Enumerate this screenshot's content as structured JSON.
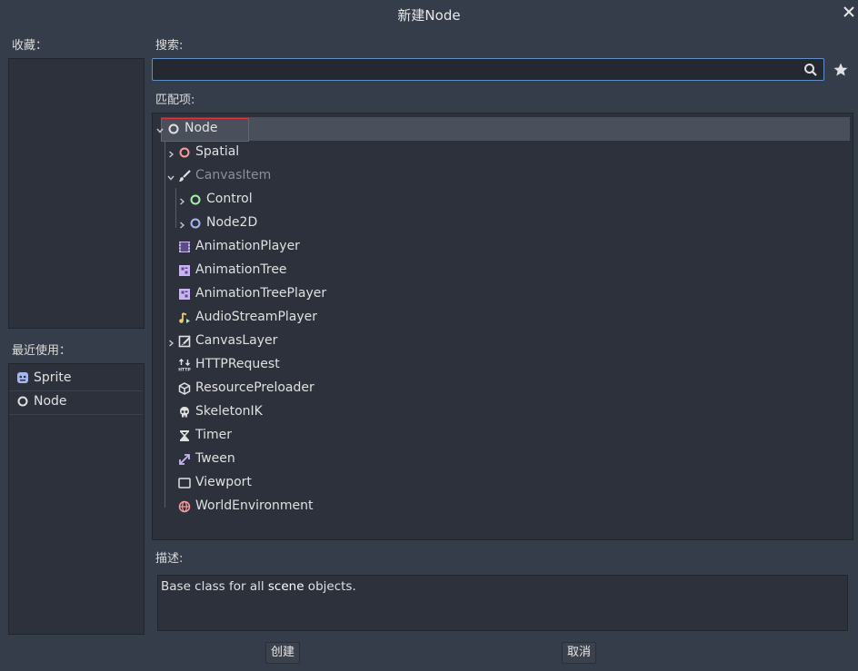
{
  "dialog": {
    "title": "新建Node"
  },
  "favorites": {
    "label": "收藏："
  },
  "recent": {
    "label": "最近使用：",
    "items": [
      {
        "label": "Sprite",
        "icon": "sprite-icon"
      },
      {
        "label": "Node",
        "icon": "node-circle-icon"
      }
    ]
  },
  "search": {
    "label": "搜索:",
    "value": "",
    "placeholder": ""
  },
  "matches": {
    "label": "匹配项:",
    "tree": [
      {
        "label": "Node",
        "icon": "node-circle-icon",
        "expanded": true,
        "selected": true
      },
      {
        "label": "Spatial",
        "icon": "spatial-circle-icon",
        "collapsed": true
      },
      {
        "label": "CanvasItem",
        "icon": "brush-icon",
        "expanded": true,
        "disabled": true
      },
      {
        "label": "Control",
        "icon": "control-circle-icon",
        "collapsed": true
      },
      {
        "label": "Node2D",
        "icon": "node2d-circle-icon",
        "collapsed": true
      },
      {
        "label": "AnimationPlayer",
        "icon": "film-icon"
      },
      {
        "label": "AnimationTree",
        "icon": "animation-tree-icon"
      },
      {
        "label": "AnimationTreePlayer",
        "icon": "animation-tree-icon"
      },
      {
        "label": "AudioStreamPlayer",
        "icon": "audio-note-icon"
      },
      {
        "label": "CanvasLayer",
        "icon": "canvas-layer-icon",
        "collapsed": true
      },
      {
        "label": "HTTPRequest",
        "icon": "http-icon"
      },
      {
        "label": "ResourcePreloader",
        "icon": "cube-icon"
      },
      {
        "label": "SkeletonIK",
        "icon": "skull-icon"
      },
      {
        "label": "Timer",
        "icon": "hourglass-icon"
      },
      {
        "label": "Tween",
        "icon": "tween-icon"
      },
      {
        "label": "Viewport",
        "icon": "viewport-icon"
      },
      {
        "label": "WorldEnvironment",
        "icon": "globe-icon"
      }
    ]
  },
  "description": {
    "label": "描述:",
    "text_before": "Base class for all ",
    "text_bold": "scene",
    "text_after": " objects."
  },
  "buttons": {
    "create": "创建",
    "cancel": "取消"
  },
  "colors": {
    "background": "#363d4a",
    "panel": "#2c313c",
    "accent_border": "#5f8fc4",
    "selection": "#4a505b",
    "highlight_outline": "#e0303a",
    "node_icon": "#e0e0e0",
    "spatial_icon": "#fc9c9c",
    "control_icon": "#a5efac",
    "node2d_icon": "#a5b7f3"
  }
}
